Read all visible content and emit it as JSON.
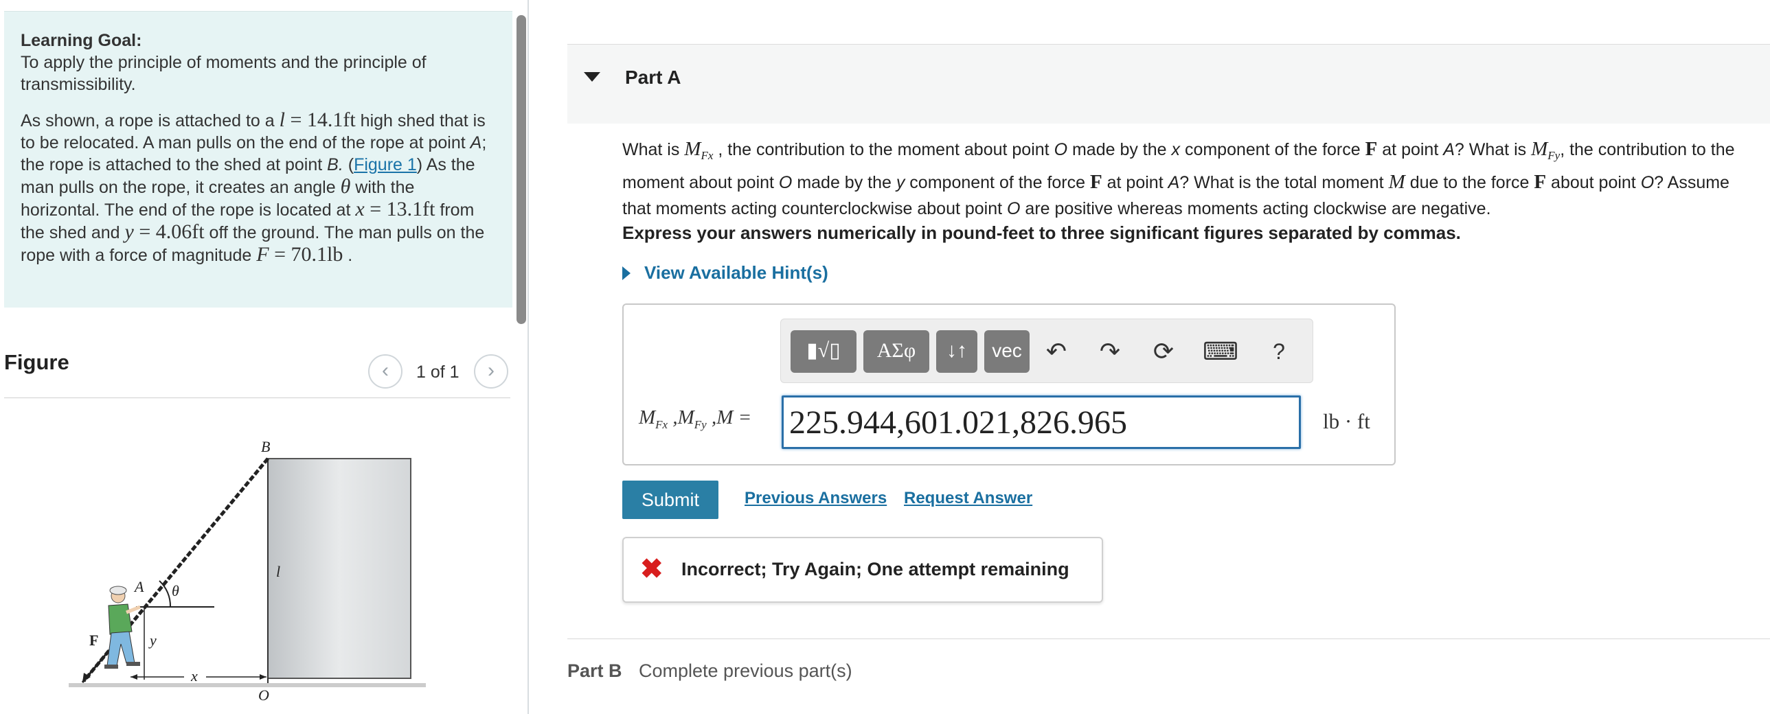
{
  "learning_goal": {
    "title": "Learning Goal:",
    "text": "To apply the principle of moments and the principle of transmissibility.",
    "p1": "As shown, a rope is attached to a ",
    "l_var": "l",
    "l_val": " = 14.1ft",
    "p2": " high shed that is to be relocated.  A man pulls on the end of the rope at point ",
    "point_A": "A",
    "p3": "; the rope is attached to the shed at point ",
    "point_B": "B.",
    "p4": " (",
    "figure_link": "Figure 1",
    "p5": ") As the man pulls on the rope, it creates an angle ",
    "theta": "θ",
    "p6": " with the horizontal.  The end of the rope is located at ",
    "x_var": "x",
    "x_val": " = 13.1ft",
    "p7": " from the shed and ",
    "y_var": "y",
    "y_val": " = 4.06ft",
    "p8": " off the ground.  The man pulls on the rope with a force of magnitude ",
    "F_var": "F",
    "F_val": " = 70.1lb",
    "p9": " ."
  },
  "figure": {
    "title": "Figure",
    "count": "1 of 1",
    "prev_icon": "‹",
    "next_icon": "›",
    "labels": {
      "B": "B",
      "A": "A",
      "theta": "θ",
      "F": "F",
      "y": "y",
      "x": "x",
      "O": "O",
      "l": "l"
    }
  },
  "partA": {
    "title": "Part A",
    "q1": "What is ",
    "MFx": "M",
    "MFx_sub": "Fx",
    "q2": " , the contribution to the moment about point ",
    "O1": "O",
    "q3": " made by the ",
    "xc": "x",
    "q4": " component of the force ",
    "F1": "F",
    "q5": " at point ",
    "A1": "A",
    "q6": "?  What is ",
    "MFy": "M",
    "MFy_sub": "Fy",
    "q7": ", the contribution to the moment about point ",
    "O2": "O",
    "q8": " made by the ",
    "yc": "y",
    "q9": " component of the force ",
    "F2": "F",
    "q10": " at point ",
    "A2": "A",
    "q11": "?  What is the total moment ",
    "M": "M",
    "q12": " due to the force ",
    "F3": "F",
    "q13": " about point ",
    "O3": "O",
    "q14": "? Assume that moments acting counterclockwise about point ",
    "O4": "O",
    "q15": " are positive whereas moments acting clockwise are negative.",
    "instruction": "Express your answers numerically in pound-feet to three significant figures separated by commas.",
    "hints": "View Available Hint(s)",
    "toolbar": {
      "template": "▮√▯",
      "greek": "ΑΣφ",
      "arrows": "↓↑",
      "vec": "vec",
      "undo": "↶",
      "redo": "↷",
      "reset": "⟳",
      "keyboard": "⌨",
      "help": "?"
    },
    "answer_label": "M",
    "answer_label_sub1": "Fx",
    "answer_label_mid": " ,M",
    "answer_label_sub2": "Fy",
    "answer_label_end": " ,M =",
    "answer_value": "225.944,601.021,826.965",
    "unit": "lb · ft",
    "submit": "Submit",
    "previous_answers": "Previous Answers",
    "request_answer": "Request Answer",
    "feedback_icon": "✖",
    "feedback": "Incorrect; Try Again; One attempt remaining"
  },
  "partB": {
    "title": "Part B",
    "status": "Complete previous part(s)"
  }
}
